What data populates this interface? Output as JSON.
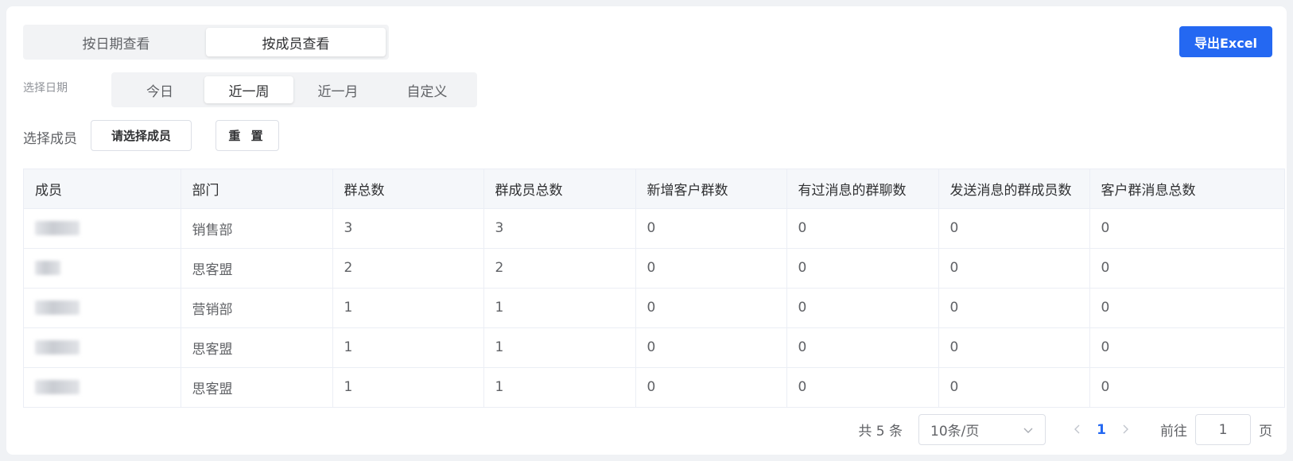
{
  "view_switch": {
    "tabs": [
      {
        "label": "按日期查看"
      },
      {
        "label": "按成员查看"
      }
    ],
    "active": 1
  },
  "export_label": "导出Excel",
  "date_filter": {
    "label": "选择日期",
    "options": [
      {
        "label": "今日"
      },
      {
        "label": "近一周"
      },
      {
        "label": "近一月"
      },
      {
        "label": "自定义"
      }
    ],
    "active": 1
  },
  "member_filter": {
    "label": "选择成员",
    "button_label": "请选择成员",
    "reset_label": "重 置"
  },
  "table": {
    "headers": [
      "成员",
      "部门",
      "群总数",
      "群成员总数",
      "新增客户群数",
      "有过消息的群聊数",
      "发送消息的群成员数",
      "客户群消息总数"
    ],
    "rows": [
      {
        "member": "",
        "dept": "销售部",
        "groups": "3",
        "members": "3",
        "new_groups": "0",
        "active_groups": "0",
        "senders": "0",
        "messages": "0"
      },
      {
        "member": "",
        "dept": "思客盟",
        "groups": "2",
        "members": "2",
        "new_groups": "0",
        "active_groups": "0",
        "senders": "0",
        "messages": "0"
      },
      {
        "member": "",
        "dept": "营销部",
        "groups": "1",
        "members": "1",
        "new_groups": "0",
        "active_groups": "0",
        "senders": "0",
        "messages": "0"
      },
      {
        "member": "",
        "dept": "思客盟",
        "groups": "1",
        "members": "1",
        "new_groups": "0",
        "active_groups": "0",
        "senders": "0",
        "messages": "0"
      },
      {
        "member": "",
        "dept": "思客盟",
        "groups": "1",
        "members": "1",
        "new_groups": "0",
        "active_groups": "0",
        "senders": "0",
        "messages": "0"
      }
    ]
  },
  "pagination": {
    "total_text": "共 5 条",
    "page_size": "10条/页",
    "current_page": "1",
    "goto_label": "前往",
    "goto_value": "1",
    "page_unit": "页"
  },
  "colors": {
    "primary": "#2468f2",
    "border": "#ebeef5",
    "header_bg": "#f5f7fa"
  }
}
